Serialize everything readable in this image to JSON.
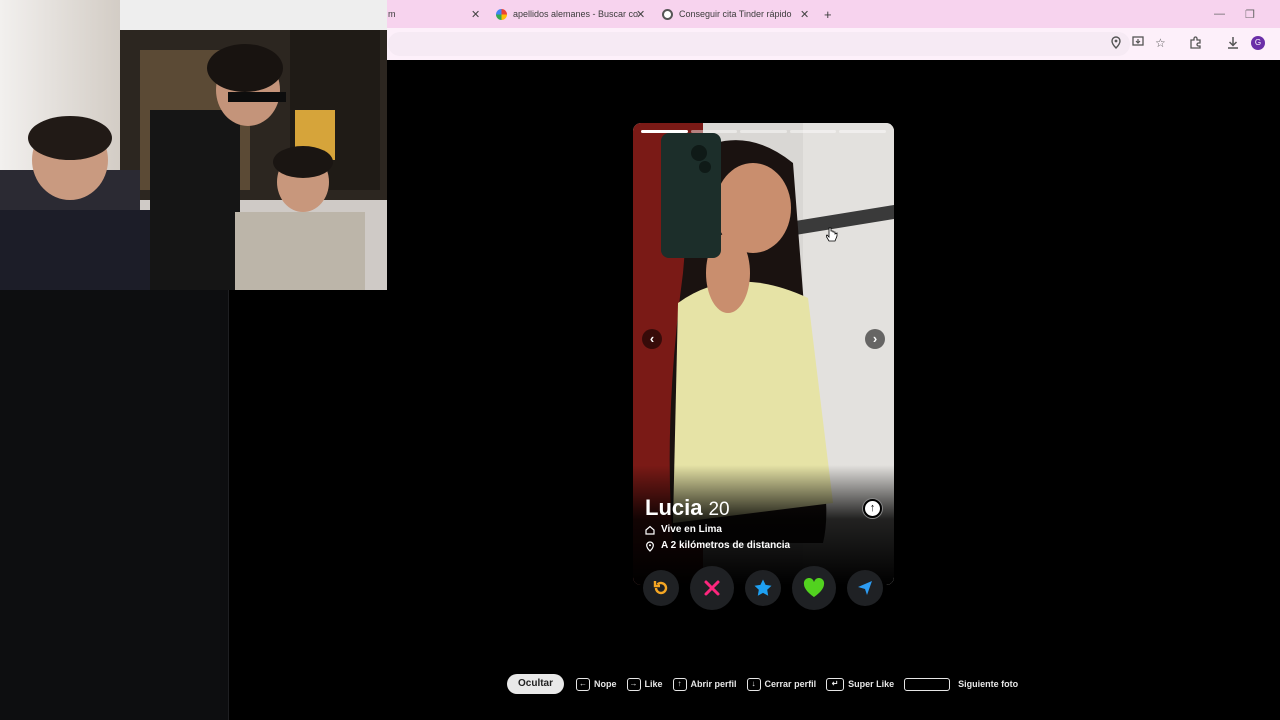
{
  "browser": {
    "tabs": [
      {
        "title": "apellidos alemanes - Buscar co"
      },
      {
        "title": "Conseguir cita Tinder rápido"
      }
    ],
    "first_tab_fragment": "m",
    "new_tab_symbol": "+",
    "profile_initial": "G"
  },
  "profile": {
    "name": "Lucia",
    "age": "20",
    "lives_in": "Vive en Lima",
    "distance": "A 2 kilómetros de distancia",
    "photo_count": 5,
    "active_photo": 1
  },
  "actions": [
    {
      "name": "rewind",
      "icon": "rewind-icon",
      "color": "#f5a623"
    },
    {
      "name": "nope",
      "icon": "x-icon",
      "color": "#fd267d"
    },
    {
      "name": "super-like",
      "icon": "star-icon",
      "color": "#1ea0f2"
    },
    {
      "name": "like",
      "icon": "heart-icon",
      "color": "#52d21f"
    },
    {
      "name": "boost",
      "icon": "send-icon",
      "color": "#2d9cf2"
    }
  ],
  "shortcuts": {
    "hide_label": "Ocultar",
    "nope": "Nope",
    "like": "Like",
    "open_profile": "Abrir perfil",
    "close_profile": "Cerrar perfil",
    "super_like": "Super Like",
    "next_photo": "Siguiente foto"
  },
  "colors": {
    "tab_bar": "#f7d3ee",
    "page_bg": "#000000"
  }
}
